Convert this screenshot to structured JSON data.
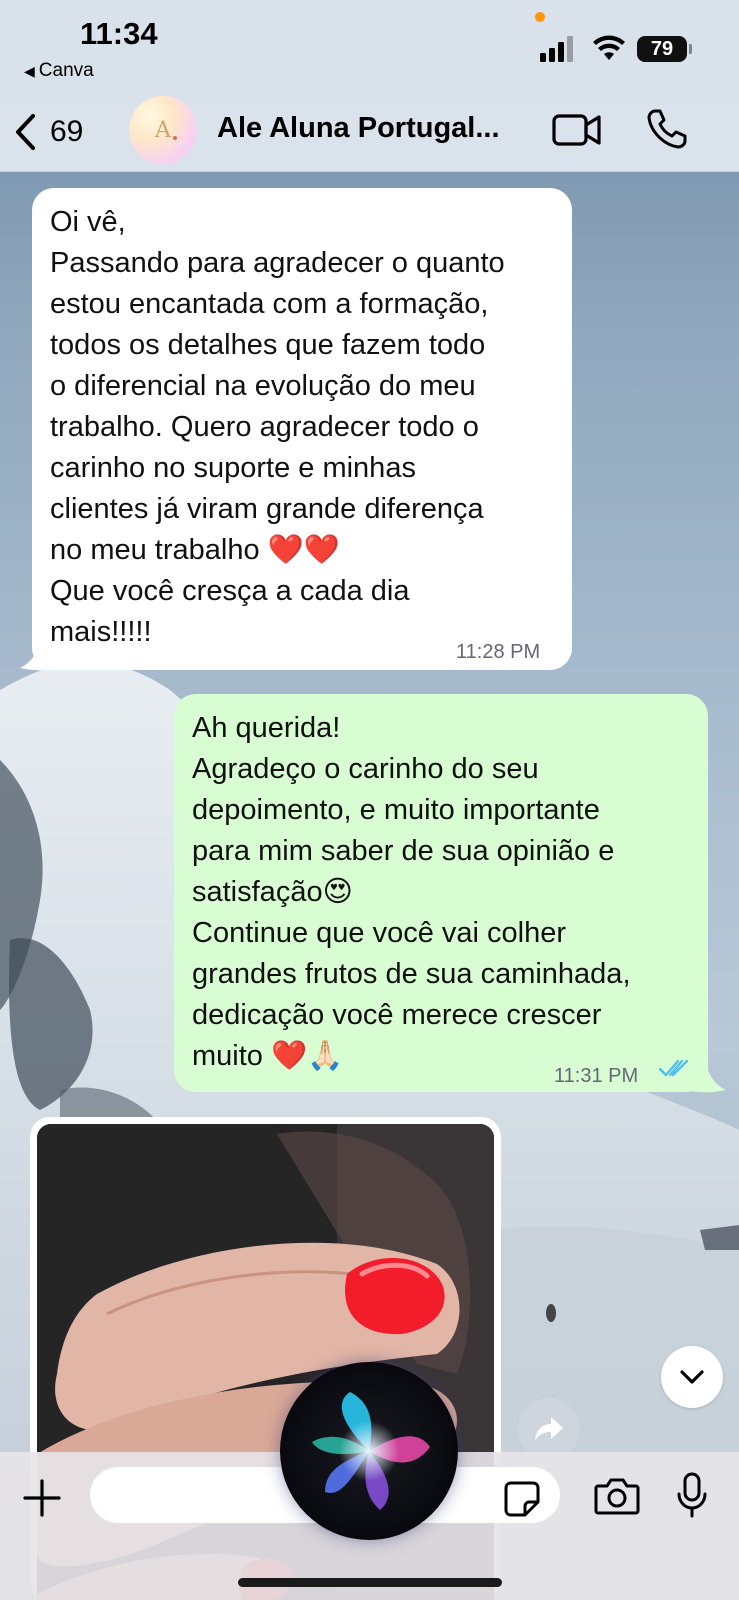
{
  "status_bar": {
    "time": "11:34",
    "back_app": "Canva",
    "battery": "79"
  },
  "header": {
    "unread_count": "69",
    "contact_name": "Ale Aluna Portugal...",
    "avatar_initial": "A"
  },
  "messages": [
    {
      "direction": "incoming",
      "lines": [
        "Oi vê,",
        "Passando para agradecer o quanto",
        "estou encantada com a formação,",
        "todos os detalhes que fazem todo",
        "o diferencial na evolução do meu",
        "trabalho. Quero agradecer todo o",
        "carinho no suporte e minhas",
        "clientes já viram grande diferença",
        "no meu trabalho ❤️❤️",
        "Que você cresça a cada dia",
        "mais!!!!!"
      ],
      "time": "11:28 PM"
    },
    {
      "direction": "outgoing",
      "lines": [
        "Ah querida!",
        "Agradeço o carinho do seu",
        "depoimento, e muito importante",
        "para mim saber de sua opinião e",
        "satisfação😍",
        "Continue que você vai colher",
        "grandes frutos de sua caminhada,",
        "dedicação você merece crescer",
        "muito ❤️🙏🏻"
      ],
      "time": "11:31 PM",
      "read_receipt_color": "#53bdeb"
    }
  ],
  "image_message": {
    "alt": "photo of red manicured nails"
  },
  "input": {
    "value": "",
    "placeholder": ""
  },
  "colors": {
    "incoming_bubble": "#ffffff",
    "outgoing_bubble": "#d9fdd3",
    "nail_red": "#f21c2a"
  }
}
